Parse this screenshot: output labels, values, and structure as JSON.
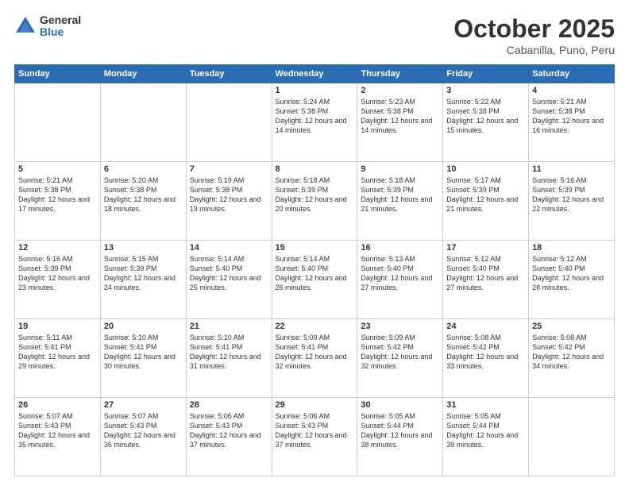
{
  "header": {
    "logo_general": "General",
    "logo_blue": "Blue",
    "title": "October 2025",
    "location": "Cabanilla, Puno, Peru"
  },
  "days_of_week": [
    "Sunday",
    "Monday",
    "Tuesday",
    "Wednesday",
    "Thursday",
    "Friday",
    "Saturday"
  ],
  "weeks": [
    [
      {
        "day": "",
        "info": ""
      },
      {
        "day": "",
        "info": ""
      },
      {
        "day": "",
        "info": ""
      },
      {
        "day": "1",
        "info": "Sunrise: 5:24 AM\nSunset: 5:38 PM\nDaylight: 12 hours\nand 14 minutes."
      },
      {
        "day": "2",
        "info": "Sunrise: 5:23 AM\nSunset: 5:38 PM\nDaylight: 12 hours\nand 14 minutes."
      },
      {
        "day": "3",
        "info": "Sunrise: 5:22 AM\nSunset: 5:38 PM\nDaylight: 12 hours\nand 15 minutes."
      },
      {
        "day": "4",
        "info": "Sunrise: 5:21 AM\nSunset: 5:38 PM\nDaylight: 12 hours\nand 16 minutes."
      }
    ],
    [
      {
        "day": "5",
        "info": "Sunrise: 5:21 AM\nSunset: 5:38 PM\nDaylight: 12 hours\nand 17 minutes."
      },
      {
        "day": "6",
        "info": "Sunrise: 5:20 AM\nSunset: 5:38 PM\nDaylight: 12 hours\nand 18 minutes."
      },
      {
        "day": "7",
        "info": "Sunrise: 5:19 AM\nSunset: 5:38 PM\nDaylight: 12 hours\nand 19 minutes."
      },
      {
        "day": "8",
        "info": "Sunrise: 5:18 AM\nSunset: 5:39 PM\nDaylight: 12 hours\nand 20 minutes."
      },
      {
        "day": "9",
        "info": "Sunrise: 5:18 AM\nSunset: 5:39 PM\nDaylight: 12 hours\nand 21 minutes."
      },
      {
        "day": "10",
        "info": "Sunrise: 5:17 AM\nSunset: 5:39 PM\nDaylight: 12 hours\nand 21 minutes."
      },
      {
        "day": "11",
        "info": "Sunrise: 5:16 AM\nSunset: 5:39 PM\nDaylight: 12 hours\nand 22 minutes."
      }
    ],
    [
      {
        "day": "12",
        "info": "Sunrise: 5:16 AM\nSunset: 5:39 PM\nDaylight: 12 hours\nand 23 minutes."
      },
      {
        "day": "13",
        "info": "Sunrise: 5:15 AM\nSunset: 5:39 PM\nDaylight: 12 hours\nand 24 minutes."
      },
      {
        "day": "14",
        "info": "Sunrise: 5:14 AM\nSunset: 5:40 PM\nDaylight: 12 hours\nand 25 minutes."
      },
      {
        "day": "15",
        "info": "Sunrise: 5:14 AM\nSunset: 5:40 PM\nDaylight: 12 hours\nand 26 minutes."
      },
      {
        "day": "16",
        "info": "Sunrise: 5:13 AM\nSunset: 5:40 PM\nDaylight: 12 hours\nand 27 minutes."
      },
      {
        "day": "17",
        "info": "Sunrise: 5:12 AM\nSunset: 5:40 PM\nDaylight: 12 hours\nand 27 minutes."
      },
      {
        "day": "18",
        "info": "Sunrise: 5:12 AM\nSunset: 5:40 PM\nDaylight: 12 hours\nand 28 minutes."
      }
    ],
    [
      {
        "day": "19",
        "info": "Sunrise: 5:11 AM\nSunset: 5:41 PM\nDaylight: 12 hours\nand 29 minutes."
      },
      {
        "day": "20",
        "info": "Sunrise: 5:10 AM\nSunset: 5:41 PM\nDaylight: 12 hours\nand 30 minutes."
      },
      {
        "day": "21",
        "info": "Sunrise: 5:10 AM\nSunset: 5:41 PM\nDaylight: 12 hours\nand 31 minutes."
      },
      {
        "day": "22",
        "info": "Sunrise: 5:09 AM\nSunset: 5:41 PM\nDaylight: 12 hours\nand 32 minutes."
      },
      {
        "day": "23",
        "info": "Sunrise: 5:09 AM\nSunset: 5:42 PM\nDaylight: 12 hours\nand 32 minutes."
      },
      {
        "day": "24",
        "info": "Sunrise: 5:08 AM\nSunset: 5:42 PM\nDaylight: 12 hours\nand 33 minutes."
      },
      {
        "day": "25",
        "info": "Sunrise: 5:08 AM\nSunset: 5:42 PM\nDaylight: 12 hours\nand 34 minutes."
      }
    ],
    [
      {
        "day": "26",
        "info": "Sunrise: 5:07 AM\nSunset: 5:43 PM\nDaylight: 12 hours\nand 35 minutes."
      },
      {
        "day": "27",
        "info": "Sunrise: 5:07 AM\nSunset: 5:43 PM\nDaylight: 12 hours\nand 36 minutes."
      },
      {
        "day": "28",
        "info": "Sunrise: 5:06 AM\nSunset: 5:43 PM\nDaylight: 12 hours\nand 37 minutes."
      },
      {
        "day": "29",
        "info": "Sunrise: 5:06 AM\nSunset: 5:43 PM\nDaylight: 12 hours\nand 37 minutes."
      },
      {
        "day": "30",
        "info": "Sunrise: 5:05 AM\nSunset: 5:44 PM\nDaylight: 12 hours\nand 38 minutes."
      },
      {
        "day": "31",
        "info": "Sunrise: 5:05 AM\nSunset: 5:44 PM\nDaylight: 12 hours\nand 39 minutes."
      },
      {
        "day": "",
        "info": ""
      }
    ]
  ]
}
